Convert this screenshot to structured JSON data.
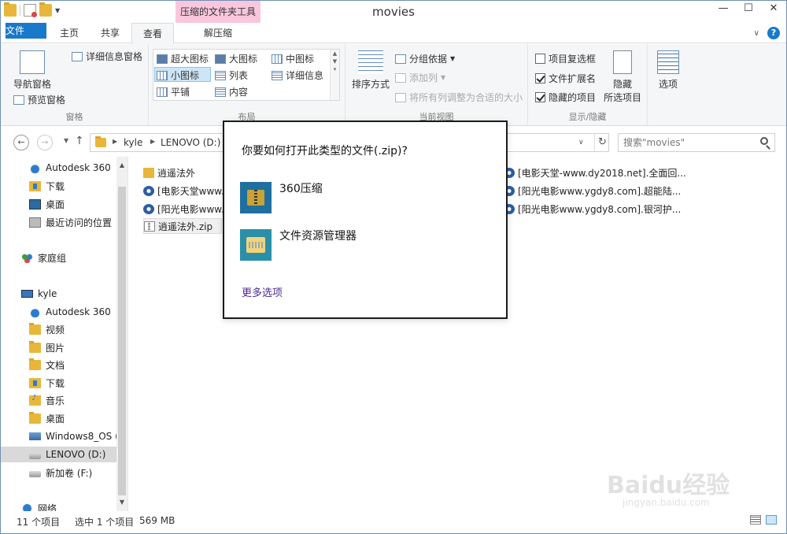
{
  "window": {
    "title": "movies",
    "context_tab": "压缩的文件夹工具",
    "buttons": [
      "—",
      "☐",
      "✕"
    ]
  },
  "tabs": {
    "file": "文件",
    "home": "主页",
    "share": "共享",
    "view": "查看",
    "extract": "解压缩"
  },
  "ribbon": {
    "panes": {
      "nav_pane": "导航窗格",
      "preview_pane": "预览窗格",
      "details_pane": "详细信息窗格",
      "label": "窗格"
    },
    "layout": {
      "extra_large": "超大图标",
      "large": "大图标",
      "medium": "中图标",
      "small": "小图标",
      "list": "列表",
      "details": "详细信息",
      "tiles": "平铺",
      "content": "内容",
      "label": "布局"
    },
    "current_view": {
      "sort_by": "排序方式",
      "group_by": "分组依据",
      "add_column": "添加列",
      "fit_columns": "将所有列调整为合适的大小",
      "label": "当前视图"
    },
    "show_hide": {
      "item_checkboxes": "项目复选框",
      "item_checkboxes_checked": false,
      "file_extensions": "文件扩展名",
      "file_extensions_checked": true,
      "hidden_items": "隐藏的项目",
      "hidden_items_checked": true,
      "hide_selected_line1": "隐藏",
      "hide_selected_line2": "所选项目",
      "label": "显示/隐藏"
    },
    "options": "选项"
  },
  "address": {
    "crumbs": [
      "kyle",
      "LENOVO (D:)"
    ],
    "search_placeholder": "搜索\"movies\""
  },
  "nav_items": [
    {
      "label": "Autodesk 360",
      "icon": "cloud"
    },
    {
      "label": "下载",
      "icon": "folder-dl"
    },
    {
      "label": "桌面",
      "icon": "desktop"
    },
    {
      "label": "最近访问的位置",
      "icon": "recent"
    },
    {
      "label": "家庭组",
      "icon": "home"
    },
    {
      "label": "kyle",
      "icon": "pc"
    },
    {
      "label": "Autodesk 360",
      "icon": "cloud"
    },
    {
      "label": "视频",
      "icon": "folder"
    },
    {
      "label": "图片",
      "icon": "folder"
    },
    {
      "label": "文档",
      "icon": "folder"
    },
    {
      "label": "下载",
      "icon": "folder-dl"
    },
    {
      "label": "音乐",
      "icon": "music"
    },
    {
      "label": "桌面",
      "icon": "folder"
    },
    {
      "label": "Windows8_OS (",
      "icon": "osdrive"
    },
    {
      "label": "LENOVO (D:)",
      "icon": "drive",
      "selected": true
    },
    {
      "label": "新加卷 (F:)",
      "icon": "drive"
    },
    {
      "label": "网络",
      "icon": "net"
    }
  ],
  "files": {
    "left": [
      {
        "name": "逍遥法外",
        "icon": "folder"
      },
      {
        "name": "[电影天堂www.",
        "icon": "rm"
      },
      {
        "name": "[阳光电影www.",
        "icon": "rm"
      },
      {
        "name": "逍遥法外.zip",
        "icon": "zip",
        "selected": true
      }
    ],
    "right": [
      {
        "name": "[电影天堂-www.dy2018.net].全面回...",
        "icon": "rm"
      },
      {
        "name": "[阳光电影www.ygdy8.com].超能陆...",
        "icon": "rm"
      },
      {
        "name": "[阳光电影www.ygdy8.com].银河护...",
        "icon": "rm"
      }
    ]
  },
  "status": {
    "count": "11 个项目",
    "selection": "选中 1 个项目",
    "size": "569 MB"
  },
  "dialog": {
    "title": "你要如何打开此类型的文件(.zip)?",
    "options": [
      "360压缩",
      "文件资源管理器"
    ],
    "more": "更多选项"
  },
  "watermark": {
    "main": "Baidu经验",
    "sub": "jingyan.baidu.com"
  },
  "colors": {
    "accent": "#1979ca",
    "context_tab": "#f9c6dc",
    "link": "#4b2b8c"
  }
}
